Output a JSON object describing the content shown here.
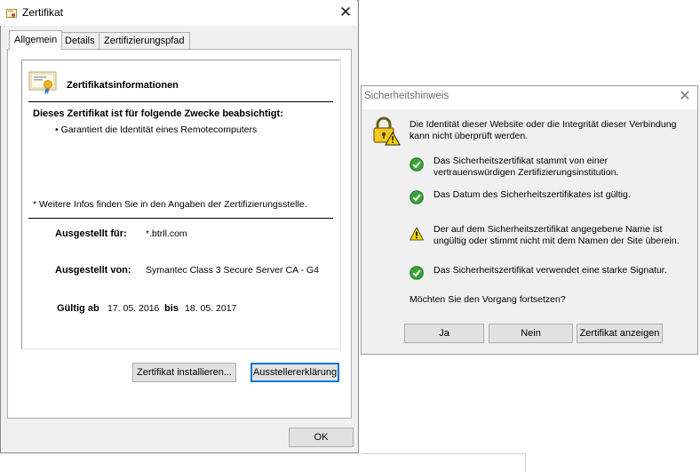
{
  "cert_window": {
    "title": "Zertifikat",
    "close_glyph": "✕",
    "tabs": [
      {
        "label": "Allgemein",
        "active": true
      },
      {
        "label": "Details",
        "active": false
      },
      {
        "label": "Zertifizierungspfad",
        "active": false
      }
    ],
    "info_heading": "Zertifikatsinformationen",
    "purposes_heading": "Dieses Zertifikat ist für folgende Zwecke beabsichtigt:",
    "purpose_item": "• Garantiert die Identität eines Remotecomputers",
    "more_info": "* Weitere Infos finden Sie in den Angaben der Zertifizierungsstelle.",
    "issued_to_label": "Ausgestellt für:",
    "issued_to_value": "*.btrll.com",
    "issued_by_label": "Ausgestellt von:",
    "issued_by_value": "Symantec Class 3 Secure Server CA - G4",
    "valid_from_label": "Gültig ab",
    "valid_from_value": "17. 05. 2016",
    "valid_to_label": "bis",
    "valid_to_value": "18. 05. 2017",
    "install_button": "Zertifikat installieren...",
    "issuer_button": "Ausstellererklärung",
    "ok_button": "OK",
    "icons": {
      "title": "certificate-icon",
      "info": "certificate-ribbon-icon"
    }
  },
  "security_dialog": {
    "title": "Sicherheitshinweis",
    "close_glyph": "✕",
    "intro": "Die Identität dieser Website oder die Integrität dieser Verbindung kann nicht überprüft werden.",
    "checks": [
      {
        "status": "ok",
        "icon": "green-check-icon",
        "text": "Das Sicherheitszertifikat stammt von einer vertrauenswürdigen Zertifizierungsinstitution."
      },
      {
        "status": "ok",
        "icon": "green-check-icon",
        "text": "Das Datum des Sicherheitszertifikates ist gültig."
      },
      {
        "status": "warning",
        "icon": "warning-triangle-icon",
        "text": "Der auf dem Sicherheitszertifikat angegebene Name ist ungültig oder stimmt nicht mit dem Namen der Site überein."
      },
      {
        "status": "ok",
        "icon": "green-check-icon",
        "text": "Das Sicherheitszertifikat verwendet eine starke Signatur."
      }
    ],
    "question": "Möchten Sie den Vorgang fortsetzen?",
    "yes_button": "Ja",
    "no_button": "Nein",
    "view_cert_button": "Zertifikat anzeigen",
    "icons": {
      "main": "padlock-warning-icon"
    }
  },
  "colors": {
    "window_bg": "#f0f0f0",
    "focus_border": "#0078d7",
    "check_green": "#3aa33a",
    "warning_yellow": "#f5d000"
  }
}
